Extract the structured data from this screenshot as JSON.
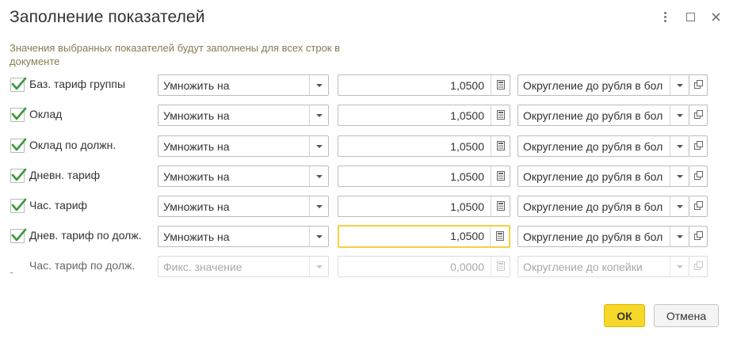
{
  "window": {
    "title": "Заполнение показателей",
    "hint": "Значения выбранных показателей будут заполнены для всех строк в документе"
  },
  "rows": [
    {
      "checked": true,
      "label": "Баз. тариф группы",
      "operation": "Умножить на",
      "value": "1,0500",
      "rounding": "Округление до рубля в бол",
      "disabled": false,
      "focused": false
    },
    {
      "checked": true,
      "label": "Оклад",
      "operation": "Умножить на",
      "value": "1,0500",
      "rounding": "Округление до рубля в бол",
      "disabled": false,
      "focused": false
    },
    {
      "checked": true,
      "label": "Оклад по должн.",
      "operation": "Умножить на",
      "value": "1,0500",
      "rounding": "Округление до рубля в бол",
      "disabled": false,
      "focused": false
    },
    {
      "checked": true,
      "label": "Дневн. тариф",
      "operation": "Умножить на",
      "value": "1,0500",
      "rounding": "Округление до рубля в бол",
      "disabled": false,
      "focused": false
    },
    {
      "checked": true,
      "label": "Час. тариф",
      "operation": "Умножить на",
      "value": "1,0500",
      "rounding": "Округление до рубля в бол",
      "disabled": false,
      "focused": false
    },
    {
      "checked": true,
      "label": "Днев. тариф по долж.",
      "operation": "Умножить на",
      "value": "1,0500",
      "rounding": "Округление до рубля в бол",
      "disabled": false,
      "focused": true
    },
    {
      "checked": false,
      "label": "Час. тариф по долж.",
      "operation": "Фикс. значение",
      "value": "0,0000",
      "rounding": "Округление до копейки",
      "disabled": true,
      "focused": false
    }
  ],
  "footer": {
    "ok_label": "ОК",
    "cancel_label": "Отмена"
  },
  "colors": {
    "accent_yellow": "#f6d72a",
    "focus_border": "#f5d044",
    "check_green": "#3a9a3a",
    "hint_text": "#8a7a52"
  },
  "icons": {
    "menu": "more-vert-icon",
    "maximize": "maximize-icon",
    "close": "close-icon",
    "dropdown": "chevron-down-icon",
    "calculator": "calculator-icon",
    "open": "open-form-icon",
    "check": "checkmark-icon"
  }
}
